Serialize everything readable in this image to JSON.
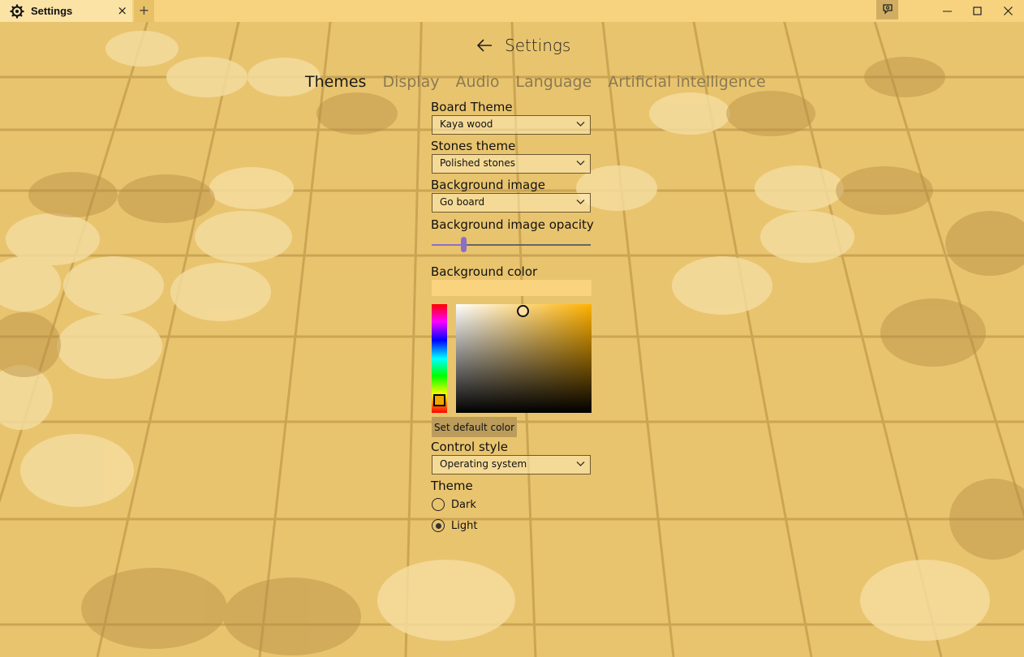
{
  "window": {
    "tab_title": "Settings",
    "tab_icon": "gear-icon",
    "close_tab_glyph": "×",
    "new_tab_glyph": "+",
    "feedback_icon": "feedback-icon",
    "minimize_glyph": "—",
    "maximize_glyph": "☐",
    "close_glyph": "✕"
  },
  "header": {
    "back_icon": "back-arrow-icon",
    "title": "Settings"
  },
  "tabs": [
    {
      "label": "Themes",
      "active": true
    },
    {
      "label": "Display",
      "active": false
    },
    {
      "label": "Audio",
      "active": false
    },
    {
      "label": "Language",
      "active": false
    },
    {
      "label": "Artificial intelligence",
      "active": false
    }
  ],
  "themes": {
    "board_theme": {
      "label": "Board Theme",
      "value": "Kaya wood"
    },
    "stones_theme": {
      "label": "Stones theme",
      "value": "Polished stones"
    },
    "background_image": {
      "label": "Background image",
      "value": "Go board"
    },
    "background_opacity": {
      "label": "Background image opacity",
      "value_fraction": 0.2
    },
    "background_color": {
      "label": "Background color",
      "current_hex": "#f9d37d",
      "hue_hex": "#f0a800",
      "default_button": "Set default color"
    },
    "control_style": {
      "label": "Control style",
      "value": "Operating system"
    },
    "theme": {
      "label": "Theme",
      "options": [
        {
          "label": "Dark",
          "checked": false
        },
        {
          "label": "Light",
          "checked": true
        }
      ]
    }
  },
  "colors": {
    "background": "#e9c46e",
    "titlebar": "#f7d27f",
    "accent": "#8a6fc9"
  }
}
